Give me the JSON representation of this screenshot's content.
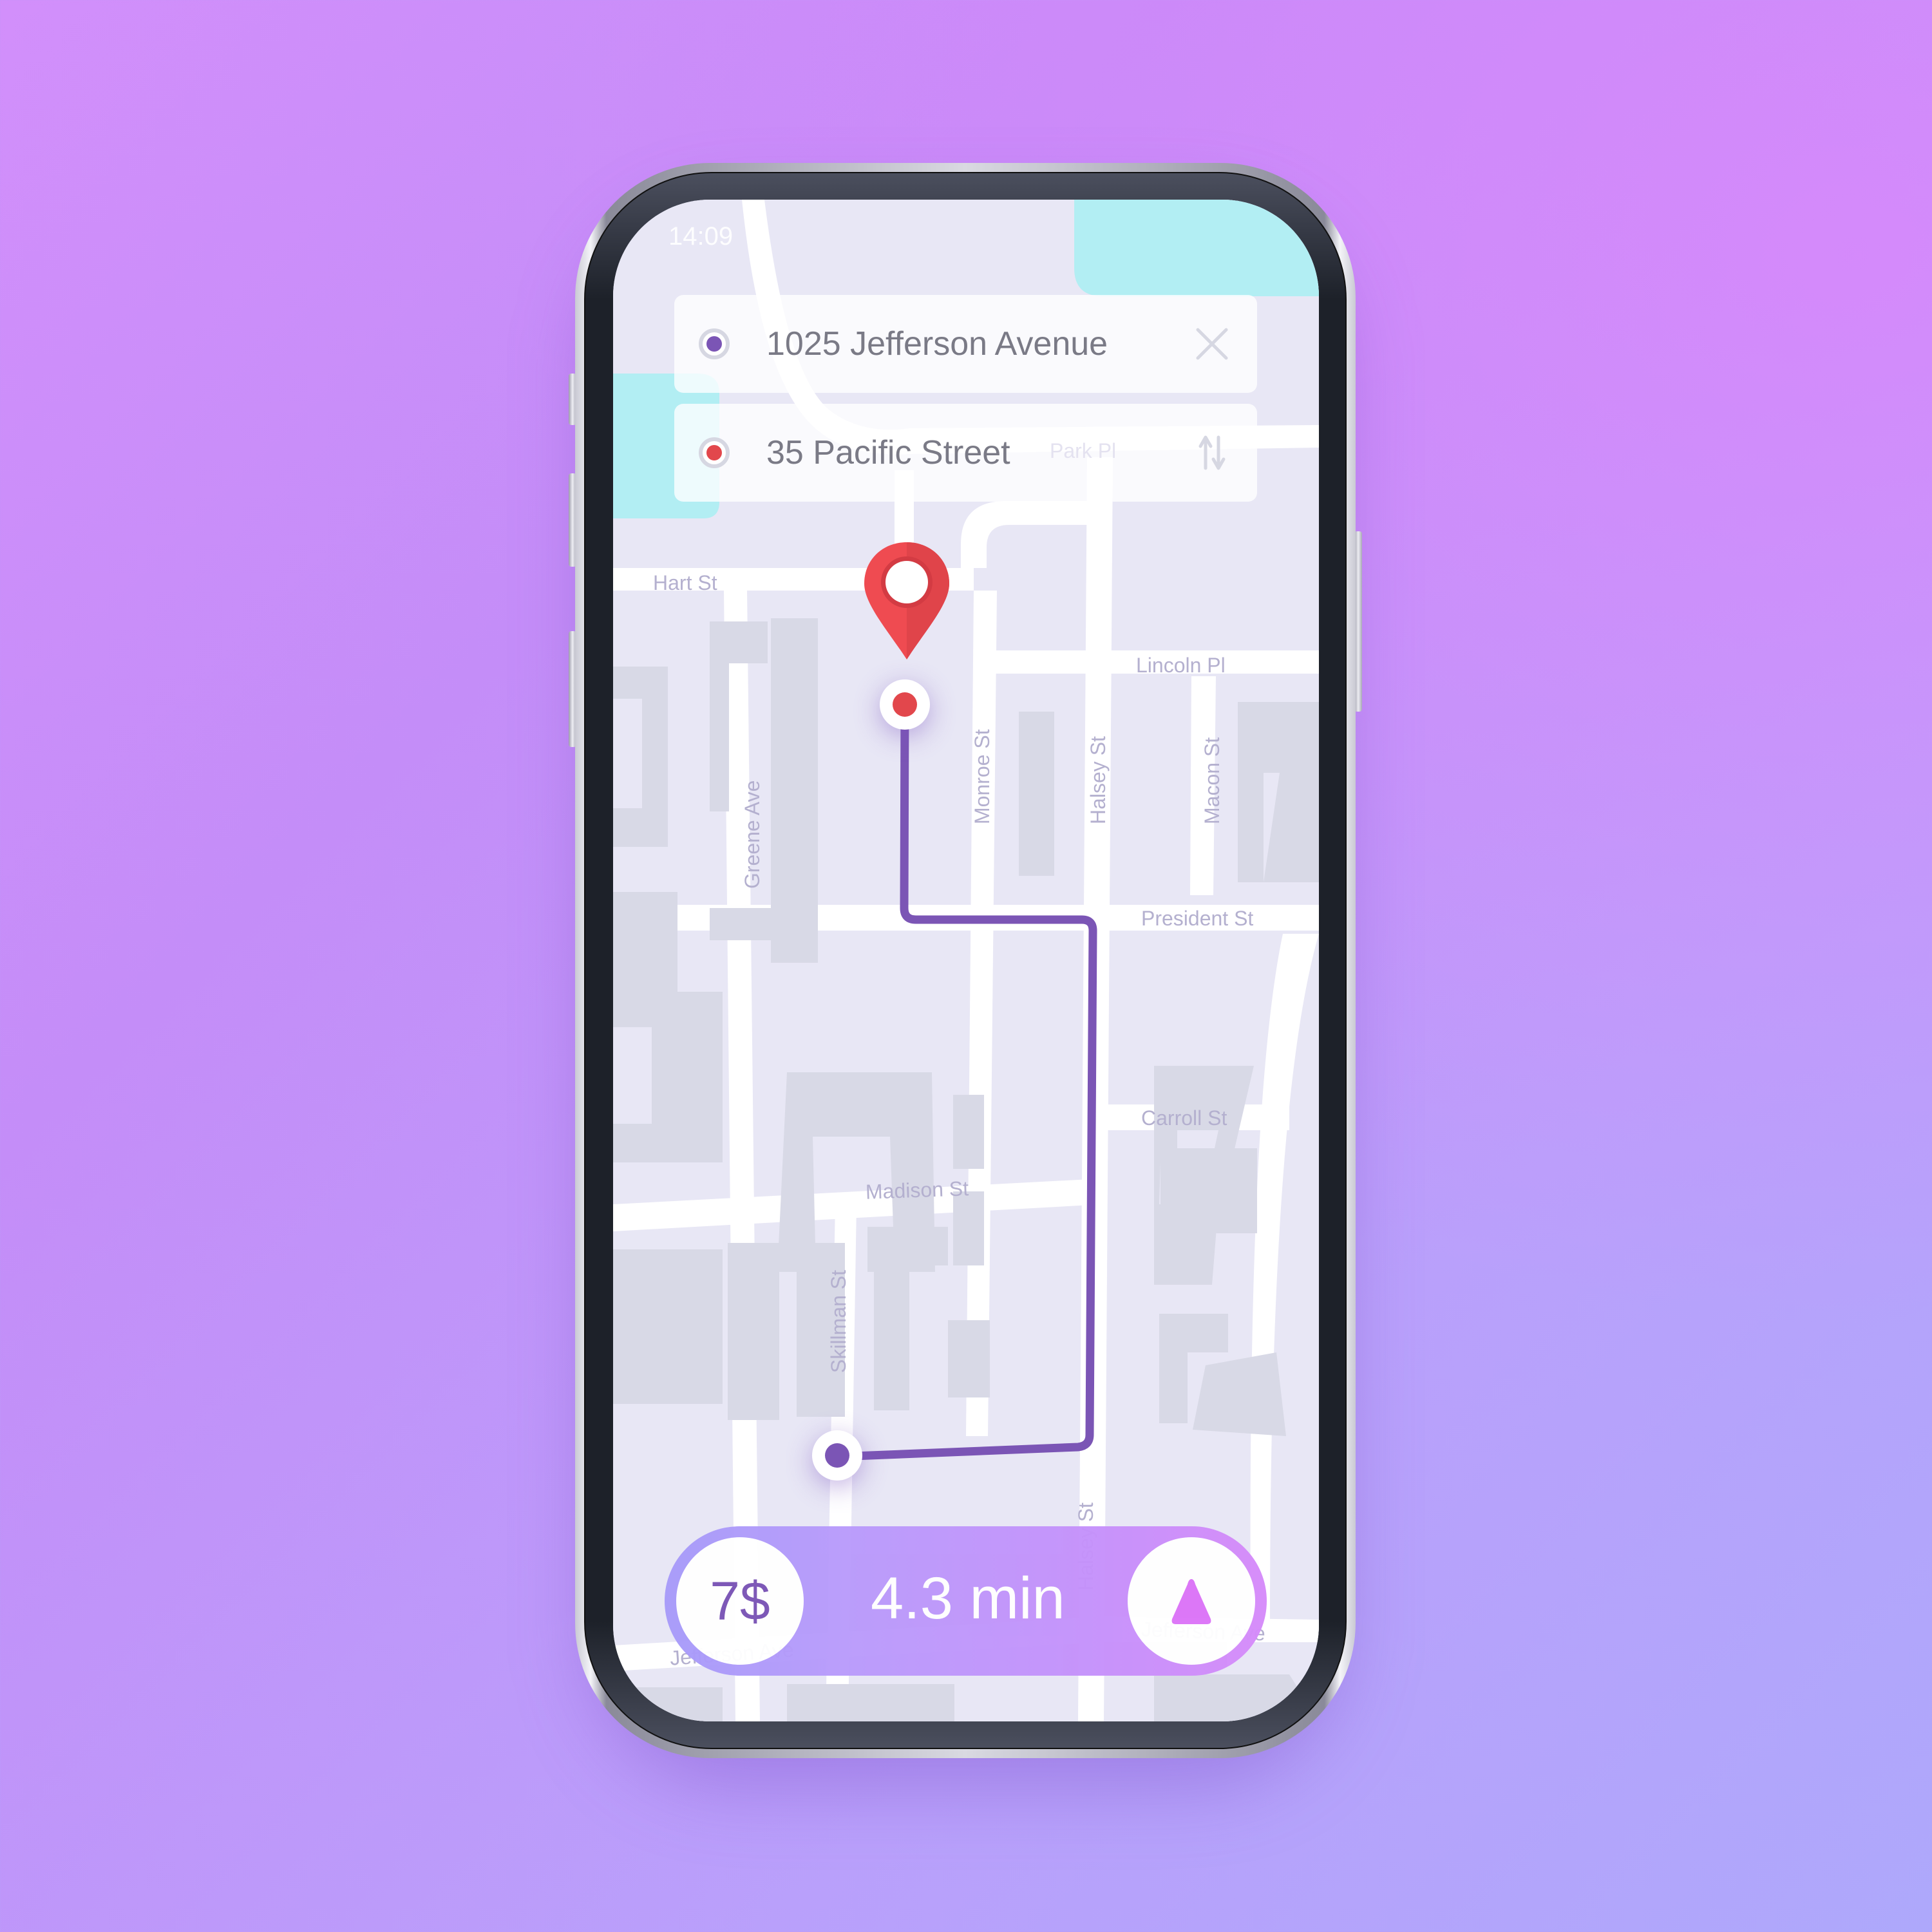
{
  "status_bar": {
    "time": "14:09"
  },
  "route_search": {
    "origin": {
      "value": "1025 Jefferson Avenue",
      "dot_color": "#7b55b5",
      "action_icon": "close-icon"
    },
    "destination": {
      "value": "35 Pacific Street",
      "dot_color": "#e2474c",
      "action_icon": "swap-vertical-icon"
    }
  },
  "map": {
    "streets": {
      "park_pl": "Park Pl",
      "hart_st": "Hart St",
      "lincoln_pl": "Lincoln Pl",
      "greene_ave": "Greene Ave",
      "monroe_st": "Monroe St",
      "halsey_st": "Halsey St",
      "macon_st": "Macon St",
      "president_st": "President St",
      "carroll_st": "Carroll St",
      "madison_st": "Madison St",
      "skillman_st": "Skillman St",
      "jefferson_ave_left": "Jefferson Ave",
      "jefferson_ave_right": "Jefferson Ave",
      "halsey_st_bottom": "Halsey St"
    },
    "colors": {
      "route": "#7b55b5",
      "pin": "#ea4a50",
      "water": "#b2eef3",
      "block": "#e8e7f5",
      "building": "#d8d9e6",
      "road": "#ffffff"
    }
  },
  "trip_summary": {
    "price": "7$",
    "eta": "4.3 min",
    "go_icon": "navigate-triangle-icon",
    "accent": "#dc74f8"
  }
}
